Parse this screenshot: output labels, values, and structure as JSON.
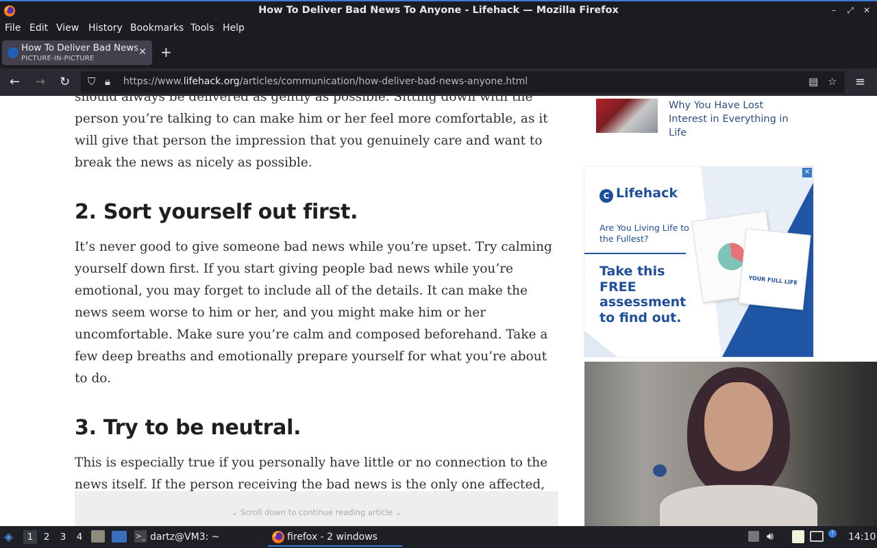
{
  "window": {
    "title": "How To Deliver Bad News To Anyone - Lifehack — Mozilla Firefox",
    "minimize": "–",
    "maximize": "⤢",
    "close": "✕"
  },
  "menu": [
    "File",
    "Edit",
    "View",
    "History",
    "Bookmarks",
    "Tools",
    "Help"
  ],
  "tab": {
    "title": "How To Deliver Bad News",
    "subtitle": "PICTURE-IN-PICTURE",
    "close": "✕",
    "new_tab": "+"
  },
  "nav": {
    "url_prefix": "https://www.",
    "url_domain": "lifehack.org",
    "url_path": "/articles/communication/how-deliver-bad-news-anyone.html"
  },
  "article": {
    "p0": "should always be delivered as gently as possible. Sitting down with the person you’re talking to can make him or her feel more comfortable, as it will give that person the impression that you genuinely care and want to break the news as nicely as possible.",
    "h2": "2. Sort yourself out first.",
    "p2": "It’s never good to give someone bad news while you’re upset. Try calming yourself down first. If you start giving people bad news while you’re emotional, you may forget to include all of the details. It can make the news seem worse to him or her, and you might make him or her uncomfortable. Make sure you’re calm and composed beforehand. Take a few deep breaths and emotionally prepare yourself for what you’re about to do.",
    "h3": "3. Try to be neutral.",
    "p3": "This is especially true if you personally have little or no connection to the news itself. If the person receiving the bad news is the only one affected, try your best to be neutral. Stick to what you know and don’t stray too far to any one side of the news.",
    "scroll_hint": "⌄ Scroll down to continue reading article ⌄"
  },
  "related": {
    "title": "Why You Have Lost Interest in Everything in Life"
  },
  "ad": {
    "brand": "Lifehack",
    "question": "Are You Living Life to the Fullest?",
    "cta": "Take this FREE assessment to find out.",
    "doc_label": "YOUR FULL LIFE",
    "close": "✕"
  },
  "taskbar": {
    "workspaces": [
      "1",
      "2",
      "3",
      "4"
    ],
    "terminal": "dartz@VM3: ~",
    "firefox": "firefox - 2 windows",
    "clock": "14:10"
  },
  "colors": {
    "accent": "#3d7bd9",
    "link": "#2a4d8a",
    "brand_blue": "#1e4e9c"
  }
}
